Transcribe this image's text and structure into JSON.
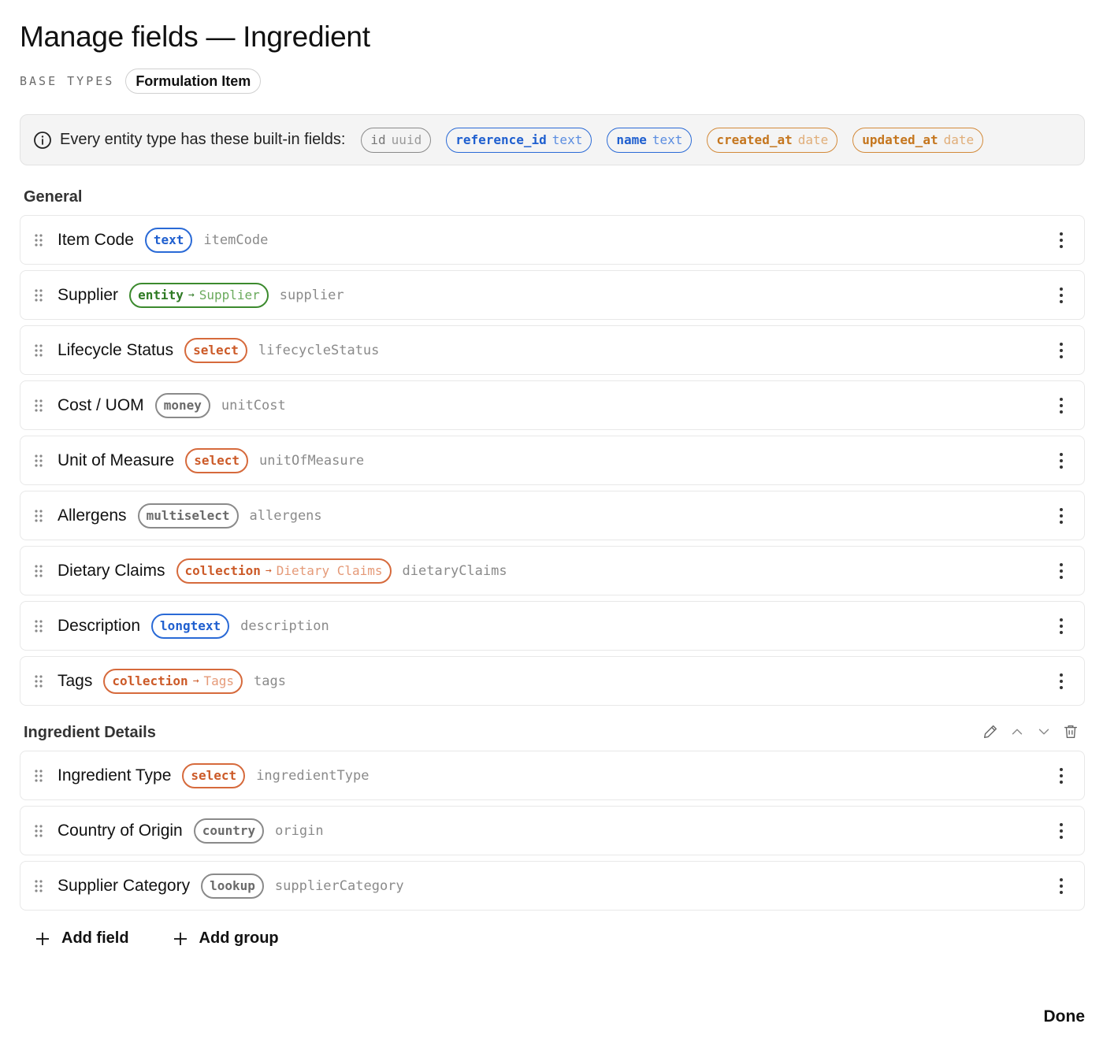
{
  "page": {
    "title": "Manage fields — Ingredient",
    "base_types_label": "BASE TYPES",
    "base_type": "Formulation Item"
  },
  "builtin": {
    "text": "Every entity type has these built-in fields:",
    "fields": [
      {
        "key": "id",
        "type": "uuid",
        "color": "gray"
      },
      {
        "key": "reference_id",
        "type": "text",
        "color": "blue"
      },
      {
        "key": "name",
        "type": "text",
        "color": "blue"
      },
      {
        "key": "created_at",
        "type": "date",
        "color": "amber"
      },
      {
        "key": "updated_at",
        "type": "date",
        "color": "amber"
      }
    ]
  },
  "groups": [
    {
      "title": "General",
      "fields": [
        {
          "label": "Item Code",
          "type": "text",
          "target": "",
          "key": "itemCode",
          "color": "blue"
        },
        {
          "label": "Supplier",
          "type": "entity",
          "target": "Supplier",
          "key": "supplier",
          "color": "green"
        },
        {
          "label": "Lifecycle Status",
          "type": "select",
          "target": "",
          "key": "lifecycleStatus",
          "color": "orange"
        },
        {
          "label": "Cost / UOM",
          "type": "money",
          "target": "",
          "key": "unitCost",
          "color": "gray"
        },
        {
          "label": "Unit of Measure",
          "type": "select",
          "target": "",
          "key": "unitOfMeasure",
          "color": "orange"
        },
        {
          "label": "Allergens",
          "type": "multiselect",
          "target": "",
          "key": "allergens",
          "color": "gray"
        },
        {
          "label": "Dietary Claims",
          "type": "collection",
          "target": "Dietary Claims",
          "key": "dietaryClaims",
          "color": "orange"
        },
        {
          "label": "Description",
          "type": "longtext",
          "target": "",
          "key": "description",
          "color": "blue"
        },
        {
          "label": "Tags",
          "type": "collection",
          "target": "Tags",
          "key": "tags",
          "color": "orange"
        }
      ]
    },
    {
      "title": "Ingredient Details",
      "fields": [
        {
          "label": "Ingredient Type",
          "type": "select",
          "target": "",
          "key": "ingredientType",
          "color": "orange"
        },
        {
          "label": "Country of Origin",
          "type": "country",
          "target": "",
          "key": "origin",
          "color": "gray"
        },
        {
          "label": "Supplier Category",
          "type": "lookup",
          "target": "",
          "key": "supplierCategory",
          "color": "gray"
        }
      ]
    }
  ],
  "actions": {
    "add_field": "Add field",
    "add_group": "Add group",
    "done": "Done"
  },
  "icons": {
    "info": "info-icon",
    "grip": "drag-handle-icon",
    "kebab": "more-vertical-icon",
    "edit": "pencil-icon",
    "up": "chevron-up-icon",
    "down": "chevron-down-icon",
    "delete": "trash-icon",
    "plus": "plus-icon",
    "arrow": "→"
  }
}
